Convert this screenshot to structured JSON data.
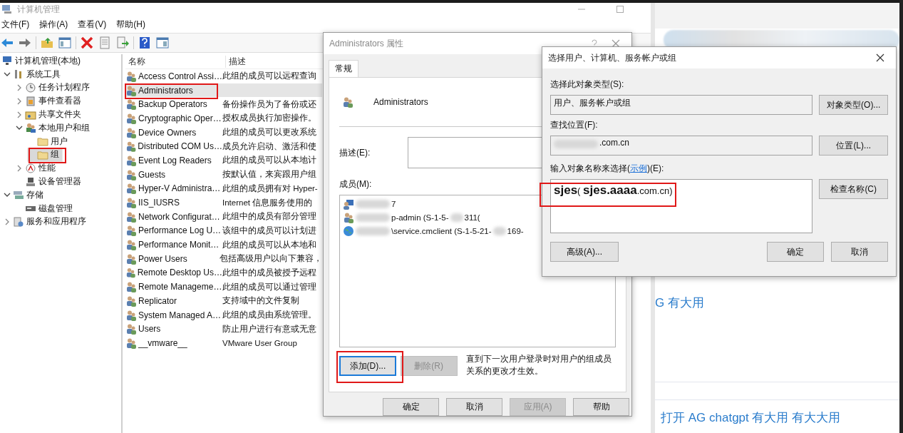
{
  "main_window": {
    "title": "计算机管理",
    "menu": [
      "文件(F)",
      "操作(A)",
      "查看(V)",
      "帮助(H)"
    ],
    "tree": [
      {
        "label": "计算机管理(本地)",
        "kind": "computer",
        "selected": false,
        "children": [
          {
            "label": "系统工具",
            "kind": "tools",
            "selected": false,
            "expanded": true,
            "children": [
              {
                "label": "任务计划程序",
                "kind": "clock",
                "selected": false,
                "expanded": false
              },
              {
                "label": "事件查看器",
                "kind": "log",
                "selected": false,
                "expanded": false
              },
              {
                "label": "共享文件夹",
                "kind": "share",
                "selected": false,
                "expanded": false
              },
              {
                "label": "本地用户和组",
                "kind": "users",
                "selected": false,
                "expanded": true,
                "children": [
                  {
                    "label": "用户",
                    "kind": "folder",
                    "selected": false
                  },
                  {
                    "label": "组",
                    "kind": "folder",
                    "selected": true
                  }
                ]
              },
              {
                "label": "性能",
                "kind": "perf",
                "selected": false,
                "expanded": false
              },
              {
                "label": "设备管理器",
                "kind": "device",
                "selected": false
              }
            ]
          },
          {
            "label": "存储",
            "kind": "storage",
            "selected": false,
            "expanded": true,
            "children": [
              {
                "label": "磁盘管理",
                "kind": "disk",
                "selected": false
              }
            ]
          },
          {
            "label": "服务和应用程序",
            "kind": "services",
            "selected": false,
            "expanded": false
          }
        ]
      }
    ],
    "list": {
      "columns": [
        "名称",
        "描述"
      ],
      "rows": [
        {
          "name": "Access Control Assi…",
          "description": "此组的成员可以远程查询",
          "selected": false
        },
        {
          "name": "Administrators",
          "selected": true
        },
        {
          "name": "Backup Operators",
          "description": "备份操作员为了备份或还",
          "selected": false
        },
        {
          "name": "Cryptographic Oper…",
          "description": "授权成员执行加密操作。",
          "selected": false
        },
        {
          "name": "Device Owners",
          "description": "此组的成员可以更改系统",
          "selected": false
        },
        {
          "name": "Distributed COM Us…",
          "description": "成员允许启动、激活和使",
          "selected": false
        },
        {
          "name": "Event Log Readers",
          "description": "此组的成员可以从本地计",
          "selected": false
        },
        {
          "name": "Guests",
          "description": "按默认值，来宾跟用户组",
          "selected": false
        },
        {
          "name": "Hyper-V Administra…",
          "description": "此组的成员拥有对 Hyper-",
          "selected": false
        },
        {
          "name": "IIS_IUSRS",
          "description": "Internet 信息服务使用的",
          "selected": false
        },
        {
          "name": "Network Configurat…",
          "description": "此组中的成员有部分管理",
          "selected": false
        },
        {
          "name": "Performance Log U…",
          "description": "该组中的成员可以计划进",
          "selected": false
        },
        {
          "name": "Performance Monit…",
          "description": "此组的成员可以从本地和",
          "selected": false
        },
        {
          "name": "Power Users",
          "description": "包括高级用户以向下兼容，",
          "selected": false
        },
        {
          "name": "Remote Desktop Us…",
          "description": "此组中的成员被授予远程",
          "selected": false
        },
        {
          "name": "Remote Manageme…",
          "description": "此组的成员可以通过管理",
          "selected": false
        },
        {
          "name": "Replicator",
          "description": "支持域中的文件复制",
          "selected": false
        },
        {
          "name": "System Managed A…",
          "description": "此组的成员由系统管理。",
          "selected": false
        },
        {
          "name": "Users",
          "description": "防止用户进行有意或无意",
          "selected": false
        },
        {
          "name": "__vmware__",
          "description": "VMware User Group",
          "selected": false
        }
      ]
    }
  },
  "properties_dialog": {
    "title": "Administrators 属性",
    "tabs": [
      {
        "label": "常规",
        "selected": true
      }
    ],
    "group_name": "Administrators",
    "description_label": "描述(E):",
    "members_label": "成员(M):",
    "members": [
      {
        "kind": "user",
        "parts": [
          "7"
        ]
      },
      {
        "kind": "group",
        "parts": [
          "p-admin (S-1-5-",
          "311("
        ]
      },
      {
        "kind": "service",
        "parts": [
          "\\service.cmclient (S-1-5-21-",
          "169-"
        ]
      }
    ],
    "member_buttons": [
      {
        "label": "添加(D)...",
        "disabled": false,
        "focused": true
      },
      {
        "label": "删除(R)",
        "disabled": true,
        "focused": false
      }
    ],
    "note": "直到下一次用户登录时对用户的组成员关系的更改才生效。",
    "footer_buttons": [
      {
        "label": "确定",
        "disabled": false
      },
      {
        "label": "取消",
        "disabled": false
      },
      {
        "label": "应用(A)",
        "disabled": true
      },
      {
        "label": "帮助",
        "disabled": false
      }
    ]
  },
  "select_dialog": {
    "title": "选择用户、计算机、服务帐户或组",
    "type_label": "选择此对象类型(S):",
    "type_value": "用户、服务帐户或组",
    "type_button": "对象类型(O)...",
    "location_label": "查找位置(F):",
    "location_value": ".com.cn",
    "location_button": "位置(L)...",
    "names_label": {
      "before": "输入对象名称来选择(",
      "link": "示例",
      "after": ")(E):"
    },
    "names_value": "**sjes**( **sjes.aaaa**.com.cn)",
    "check_button": "检查名称(C)",
    "advanced_button": "高级(A)...",
    "ok_button": "确定",
    "cancel_button": "取消"
  },
  "background_page": {
    "texts": [
      "G 有大用",
      "打开 AG chatgpt 有大用 有大大用"
    ]
  }
}
